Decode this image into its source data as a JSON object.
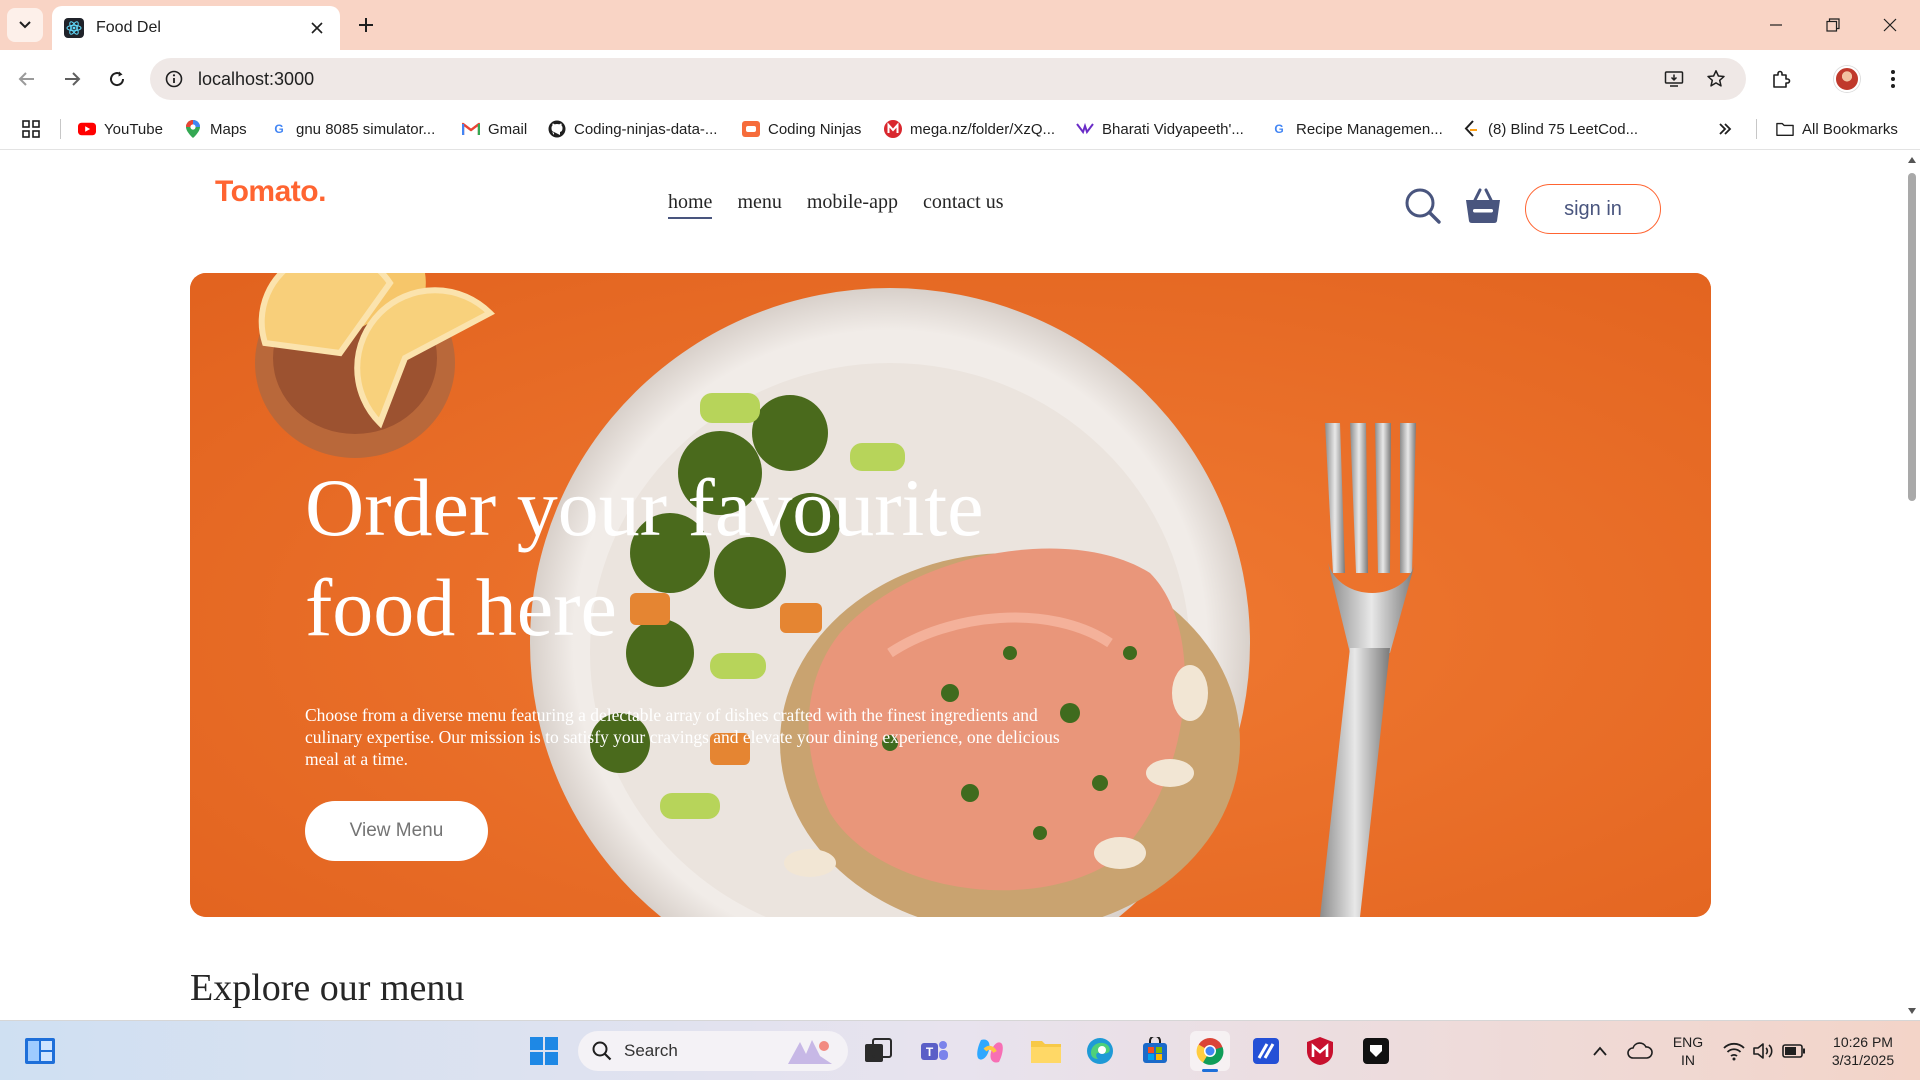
{
  "browser": {
    "tab_title": "Food Del",
    "url": "localhost:3000",
    "bookmarks": [
      {
        "label": "YouTube",
        "icon": "youtube-icon"
      },
      {
        "label": "Maps",
        "icon": "maps-icon"
      },
      {
        "label": "gnu 8085 simulator...",
        "icon": "google-icon"
      },
      {
        "label": "Gmail",
        "icon": "gmail-icon"
      },
      {
        "label": "Coding-ninjas-data-...",
        "icon": "github-icon"
      },
      {
        "label": "Coding Ninjas",
        "icon": "coding-ninjas-icon"
      },
      {
        "label": "mega.nz/folder/XzQ...",
        "icon": "mega-icon"
      },
      {
        "label": "Bharati Vidyapeeth'...",
        "icon": "bharati-icon"
      },
      {
        "label": "Recipe Managemen...",
        "icon": "google-icon"
      },
      {
        "label": "(8) Blind 75 LeetCod...",
        "icon": "leetcode-icon"
      }
    ],
    "all_bookmarks": "All Bookmarks"
  },
  "site": {
    "logo": "Tomato.",
    "nav": [
      "home",
      "menu",
      "mobile-app",
      "contact us"
    ],
    "signin": "sign in",
    "hero": {
      "title": "Order your favourite food here",
      "text": "Choose from a diverse menu featuring a delectable array of dishes crafted with the finest ingredients and culinary expertise. Our mission is to satisfy your cravings and elevate your dining experience, one delicious meal at a time.",
      "button": "View Menu"
    },
    "section_title": "Explore our menu"
  },
  "taskbar": {
    "search_label": "Search",
    "lang_line1": "ENG",
    "lang_line2": "IN",
    "time": "10:26 PM",
    "date": "3/31/2025"
  },
  "colors": {
    "accent": "#ff6431",
    "hero_bg": "#ec6f2b",
    "nav_text": "#49557e",
    "tabstrip": "#f9d4c5"
  }
}
